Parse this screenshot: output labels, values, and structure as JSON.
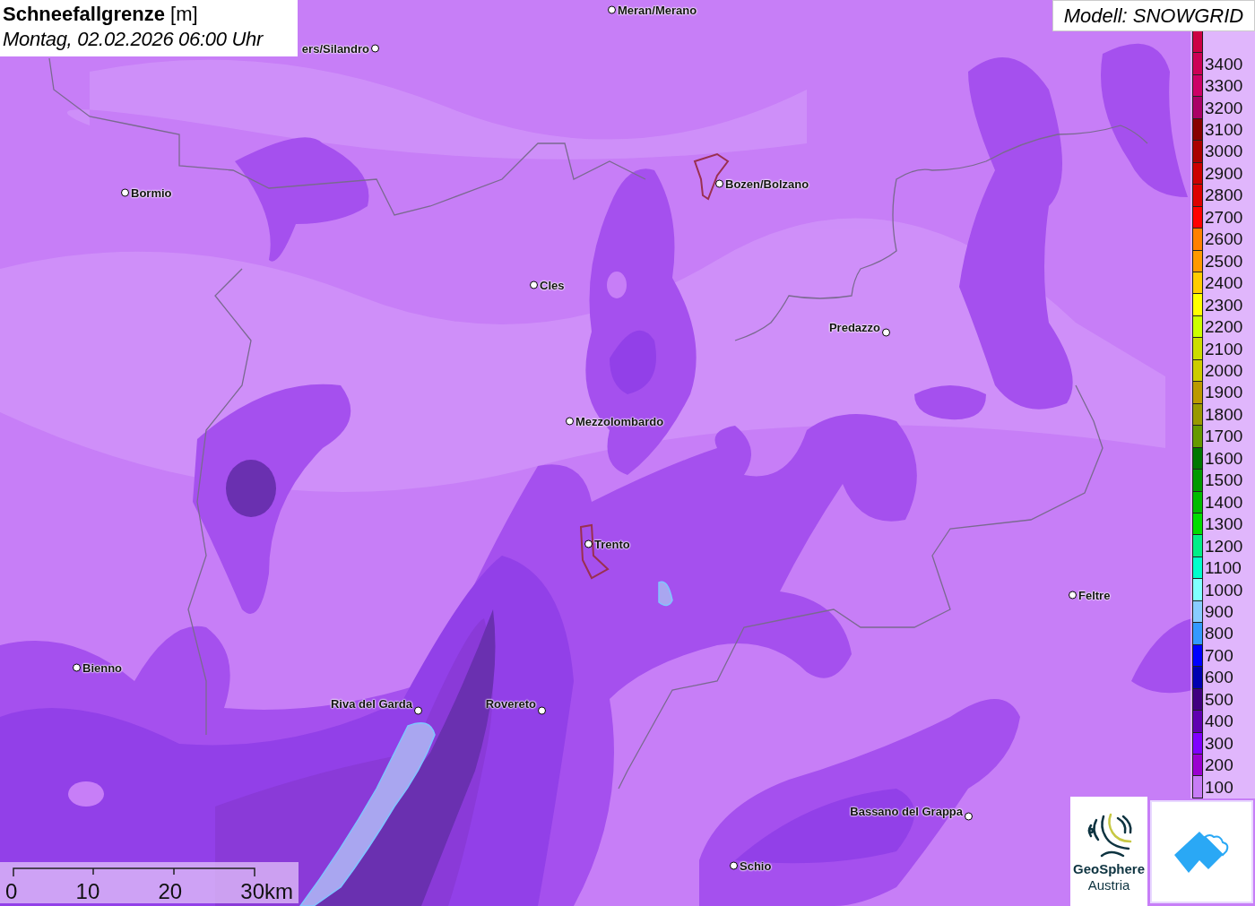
{
  "title": {
    "variable": "Schneefallgrenze",
    "unit": "[m]",
    "time": "Montag, 02.02.2026 06:00 Uhr"
  },
  "model": "Modell: SNOWGRID",
  "places": [
    {
      "name": "Meran/Merano"
    },
    {
      "name": "ers/Silandro"
    },
    {
      "name": "Bormio"
    },
    {
      "name": "Bozen/Bolzano"
    },
    {
      "name": "Cles"
    },
    {
      "name": "Predazzo"
    },
    {
      "name": "Mezzolombardo"
    },
    {
      "name": "Trento"
    },
    {
      "name": "Feltre"
    },
    {
      "name": "Bienno"
    },
    {
      "name": "Riva del Garda"
    },
    {
      "name": "Rovereto"
    },
    {
      "name": "Bassano del Grappa"
    },
    {
      "name": "Schio"
    }
  ],
  "legend": [
    {
      "color": "#cc0044"
    },
    {
      "label": "3400",
      "color": "#cc0055"
    },
    {
      "label": "3300",
      "color": "#cc0066"
    },
    {
      "label": "3200",
      "color": "#aa0066"
    },
    {
      "label": "3100",
      "color": "#880000"
    },
    {
      "label": "3000",
      "color": "#aa0000"
    },
    {
      "label": "2900",
      "color": "#cc0000"
    },
    {
      "label": "2800",
      "color": "#dd0000"
    },
    {
      "label": "2700",
      "color": "#ff0000"
    },
    {
      "label": "2600",
      "color": "#ff8000"
    },
    {
      "label": "2500",
      "color": "#ff9900"
    },
    {
      "label": "2400",
      "color": "#ffcc00"
    },
    {
      "label": "2300",
      "color": "#ffff00"
    },
    {
      "label": "2200",
      "color": "#ccff00"
    },
    {
      "label": "2100",
      "color": "#ccdd00"
    },
    {
      "label": "2000",
      "color": "#cccc00"
    },
    {
      "label": "1900",
      "color": "#bb9900"
    },
    {
      "label": "1800",
      "color": "#999900"
    },
    {
      "label": "1700",
      "color": "#669900"
    },
    {
      "label": "1600",
      "color": "#007700"
    },
    {
      "label": "1500",
      "color": "#009900"
    },
    {
      "label": "1400",
      "color": "#00bb00"
    },
    {
      "label": "1300",
      "color": "#00dd00"
    },
    {
      "label": "1200",
      "color": "#00ee88"
    },
    {
      "label": "1100",
      "color": "#00ffcc"
    },
    {
      "label": "1000",
      "color": "#80ffff"
    },
    {
      "label": "900",
      "color": "#88ccff"
    },
    {
      "label": "800",
      "color": "#3399ff"
    },
    {
      "label": "700",
      "color": "#0000ff"
    },
    {
      "label": "600",
      "color": "#0000b0"
    },
    {
      "label": "500",
      "color": "#400080"
    },
    {
      "label": "400",
      "color": "#6000b0"
    },
    {
      "label": "300",
      "color": "#8000ff"
    },
    {
      "label": "200",
      "color": "#9a00d0"
    },
    {
      "label": "100",
      "color": "#c77cf5"
    }
  ],
  "scale": {
    "ticks": [
      "0",
      "10",
      "20",
      "30km"
    ]
  },
  "logo": {
    "line_1": "GeoSphere",
    "line_2": "Austria"
  }
}
